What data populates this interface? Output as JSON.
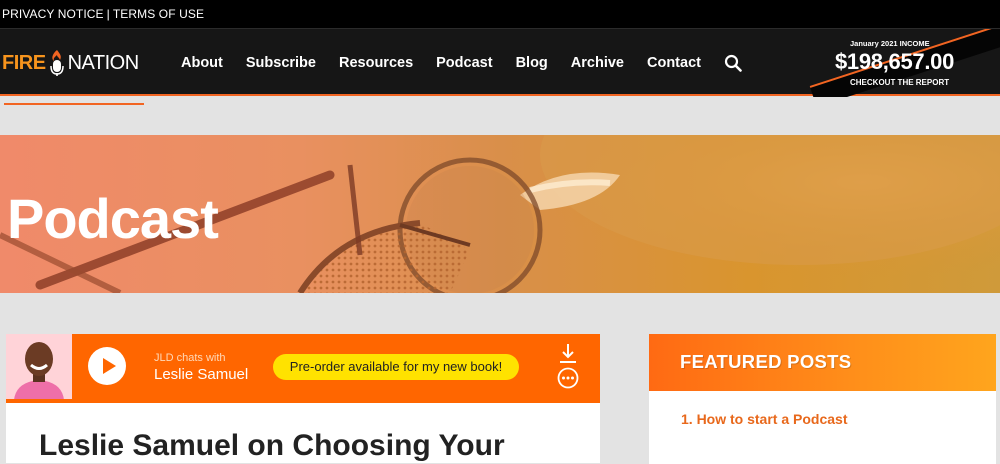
{
  "topbar": {
    "privacy": "PRIVACY NOTICE",
    "separator": "|",
    "terms": "TERMS OF USE"
  },
  "logo": {
    "fire": "FIRE",
    "nation": "NATION"
  },
  "nav": {
    "items": [
      "About",
      "Subscribe",
      "Resources",
      "Podcast",
      "Blog",
      "Archive",
      "Contact"
    ]
  },
  "income": {
    "label": "January 2021 INCOME",
    "amount": "$198,657.00",
    "cta": "CHECKOUT THE REPORT"
  },
  "hero": {
    "title": "Podcast"
  },
  "player": {
    "chats_with": "JLD chats with",
    "guest": "Leslie Samuel",
    "cta": "Pre-order available for my new book!"
  },
  "article": {
    "title": "Leslie Samuel on Choosing Your"
  },
  "featured": {
    "heading": "FEATURED POSTS",
    "items": [
      "1. How to start a Podcast"
    ]
  },
  "colors": {
    "brand_orange": "#ff6600",
    "accent_yellow": "#ffe200",
    "nav_bg": "#161616"
  }
}
